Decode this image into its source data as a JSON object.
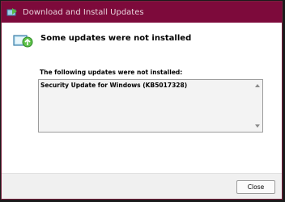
{
  "window": {
    "title": "Download and Install Updates",
    "title_icon": "update-icon",
    "accent_color": "#7d0a3b"
  },
  "content": {
    "icon": "update-installer-icon",
    "heading": "Some updates were not installed",
    "list_label": "The following updates were not installed:",
    "updates": [
      "Security Update for Windows (KB5017328)"
    ]
  },
  "footer": {
    "close_label": "Close"
  }
}
